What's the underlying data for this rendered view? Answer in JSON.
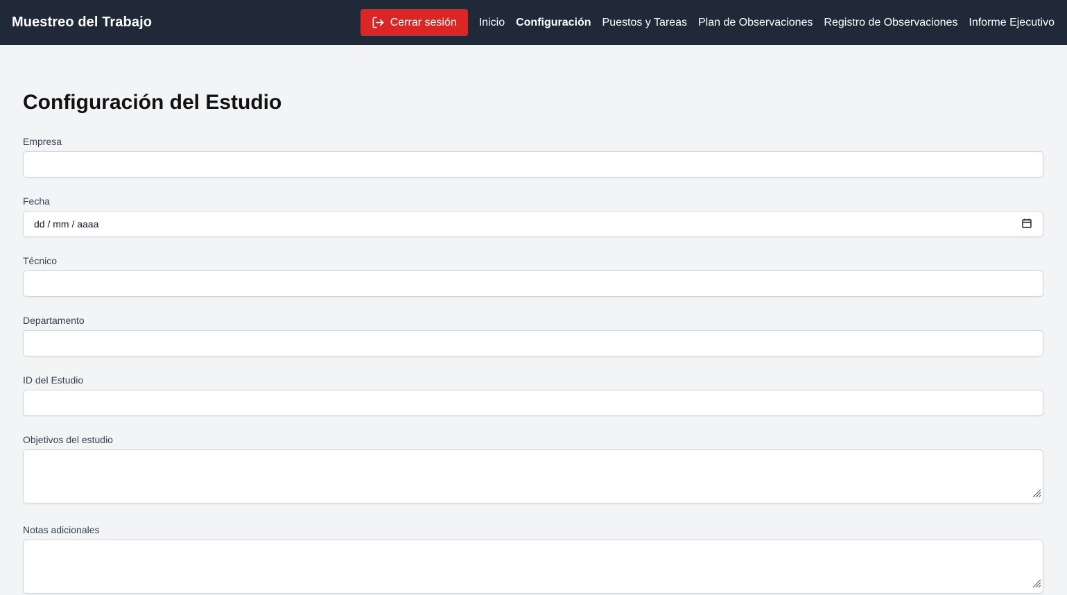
{
  "header": {
    "brand": "Muestreo del Trabajo",
    "logout_label": "Cerrar sesión",
    "nav": [
      {
        "label": "Inicio",
        "active": false
      },
      {
        "label": "Configuración",
        "active": true
      },
      {
        "label": "Puestos y Tareas",
        "active": false
      },
      {
        "label": "Plan de Observaciones",
        "active": false
      },
      {
        "label": "Registro de Observaciones",
        "active": false
      },
      {
        "label": "Informe Ejecutivo",
        "active": false
      }
    ],
    "colors": {
      "bg": "#1f2937",
      "logout": "#dc2626"
    }
  },
  "main": {
    "title": "Configuración del Estudio",
    "fields": {
      "empresa": {
        "label": "Empresa",
        "value": ""
      },
      "fecha": {
        "label": "Fecha",
        "placeholder": "dd / mm / aaaa",
        "icon": "calendar-icon"
      },
      "tecnico": {
        "label": "Técnico",
        "value": ""
      },
      "departamento": {
        "label": "Departamento",
        "value": ""
      },
      "id_estudio": {
        "label": "ID del Estudio",
        "value": ""
      },
      "objetivos": {
        "label": "Objetivos del estudio",
        "value": ""
      },
      "notas": {
        "label": "Notas adicionales",
        "value": ""
      }
    }
  }
}
